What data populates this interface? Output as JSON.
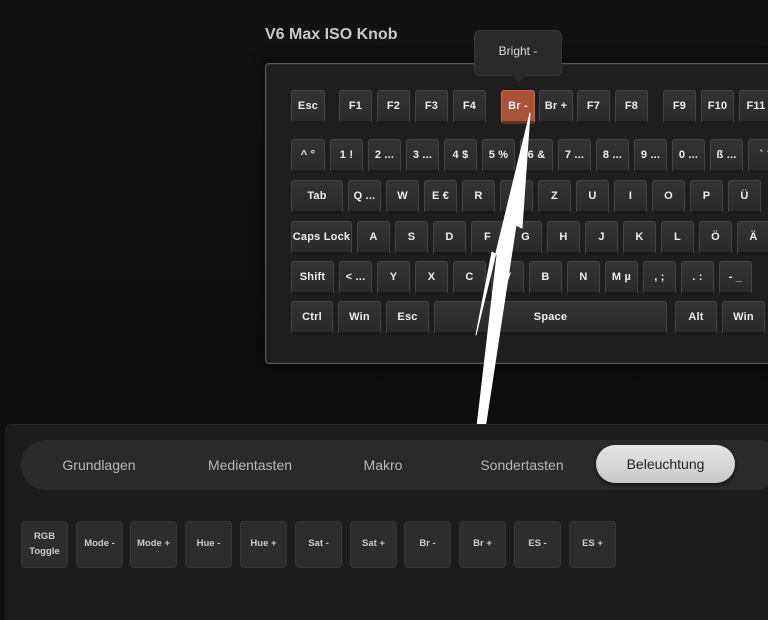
{
  "title": "V6 Max ISO Knob",
  "tooltip": "Bright -",
  "accent": "#a9523a",
  "keyboard": {
    "row1": [
      "Esc",
      "F1",
      "F2",
      "F3",
      "F4",
      "Br -",
      "Br +",
      "F7",
      "F8",
      "F9",
      "F10",
      "F11"
    ],
    "row2": [
      "^ °",
      "1 !",
      "2 ...",
      "3 ...",
      "4 $",
      "5 %",
      "6 &",
      "7 ...",
      "8 ...",
      "9 ...",
      "0 ...",
      "ß ...",
      "` ´"
    ],
    "row3": [
      "Tab",
      "Q ...",
      "W",
      "E €",
      "R",
      "T",
      "Z",
      "U",
      "I",
      "O",
      "P",
      "Ü"
    ],
    "row4": [
      "Caps Lock",
      "A",
      "S",
      "D",
      "F",
      "G",
      "H",
      "J",
      "K",
      "L",
      "Ö",
      "Ä"
    ],
    "row5": [
      "Shift",
      "< ...",
      "Y",
      "X",
      "C",
      "V",
      "B",
      "N",
      "M µ",
      ", ;",
      ". :",
      "- _"
    ],
    "row6": [
      "Ctrl",
      "Win",
      "Esc",
      "Space",
      "Alt",
      "Win"
    ]
  },
  "tabs": [
    "Grundlagen",
    "Medientasten",
    "Makro",
    "Sondertasten",
    "Beleuchtung"
  ],
  "active_tab": "Beleuchtung",
  "lighting_keys": [
    {
      "line1": "RGB",
      "line2": "Toggle"
    },
    {
      "line1": "Mode -",
      "line2": ""
    },
    {
      "line1": "Mode +",
      "line2": ""
    },
    {
      "line1": "Hue -",
      "line2": ""
    },
    {
      "line1": "Hue +",
      "line2": ""
    },
    {
      "line1": "Sat -",
      "line2": ""
    },
    {
      "line1": "Sat +",
      "line2": ""
    },
    {
      "line1": "Br -",
      "line2": ""
    },
    {
      "line1": "Br +",
      "line2": ""
    },
    {
      "line1": "ES -",
      "line2": ""
    },
    {
      "line1": "ES +",
      "line2": ""
    }
  ]
}
